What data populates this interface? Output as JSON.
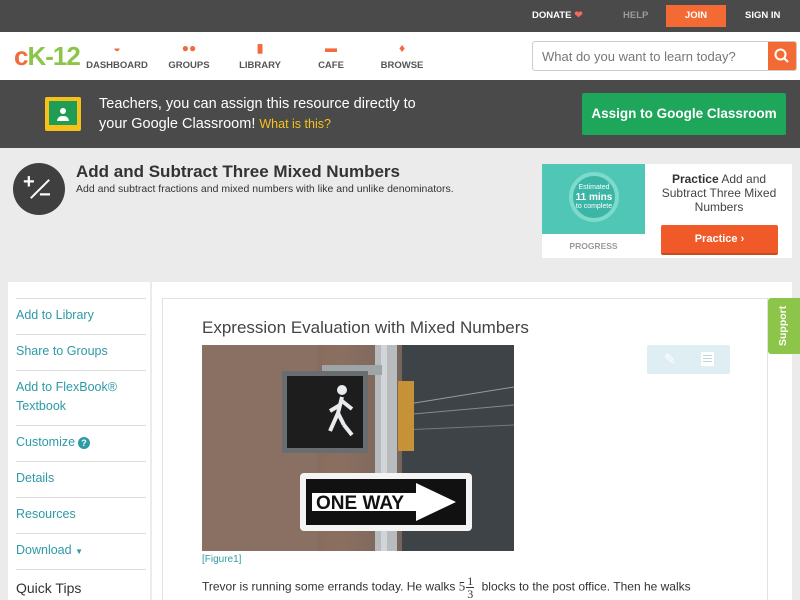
{
  "topbar": {
    "donate": "DONATE",
    "help": "HELP",
    "join": "JOIN",
    "signin": "SIGN IN"
  },
  "logo": {
    "c": "c",
    "k": "K",
    "dash": "-",
    "num": "12"
  },
  "nav": [
    {
      "label": "DASHBOARD",
      "icon": "dashboard-icon"
    },
    {
      "label": "GROUPS",
      "icon": "groups-icon"
    },
    {
      "label": "LIBRARY",
      "icon": "library-icon"
    },
    {
      "label": "CAFE",
      "icon": "cafe-icon"
    },
    {
      "label": "BROWSE",
      "icon": "browse-icon"
    }
  ],
  "search": {
    "placeholder": "What do you want to learn today?"
  },
  "banner": {
    "text_line1": "Teachers, you can assign this resource directly to",
    "text_line2": "your Google Classroom!",
    "what_link": "What is this?",
    "assign_button": "Assign to Google Classroom"
  },
  "concept": {
    "title": "Add and Subtract Three Mixed Numbers",
    "subtitle": "Add and subtract fractions and mixed numbers with like and unlike denominators."
  },
  "practice": {
    "estimated": "Estimated",
    "mins": "11 mins",
    "to_complete": "to complete",
    "progress_label": "PROGRESS",
    "title_bold": "Practice",
    "title_rest": "Add and Subtract Three Mixed Numbers",
    "button": "Practice"
  },
  "sidebar": {
    "items": [
      {
        "label": "Add to Library"
      },
      {
        "label": "Share to Groups"
      },
      {
        "label": "Add to FlexBook® Textbook"
      },
      {
        "label": "Customize"
      },
      {
        "label": "Details"
      },
      {
        "label": "Resources"
      },
      {
        "label": "Download"
      }
    ],
    "quick_tips": "Quick Tips"
  },
  "lesson": {
    "title": "Expression Evaluation with Mixed Numbers",
    "sign_text": "ONE WAY",
    "figure_ref": "[Figure1]",
    "para_start": "Trevor is running some errands today. He walks",
    "whole": "5",
    "num": "1",
    "den": "3",
    "para_end": "blocks to the post office. Then he walks"
  },
  "support_tab": "Support",
  "colors": {
    "accent": "#f36a35",
    "link": "#2e9aa6",
    "green": "#1ea65a",
    "brand_green": "#8dc54b"
  }
}
